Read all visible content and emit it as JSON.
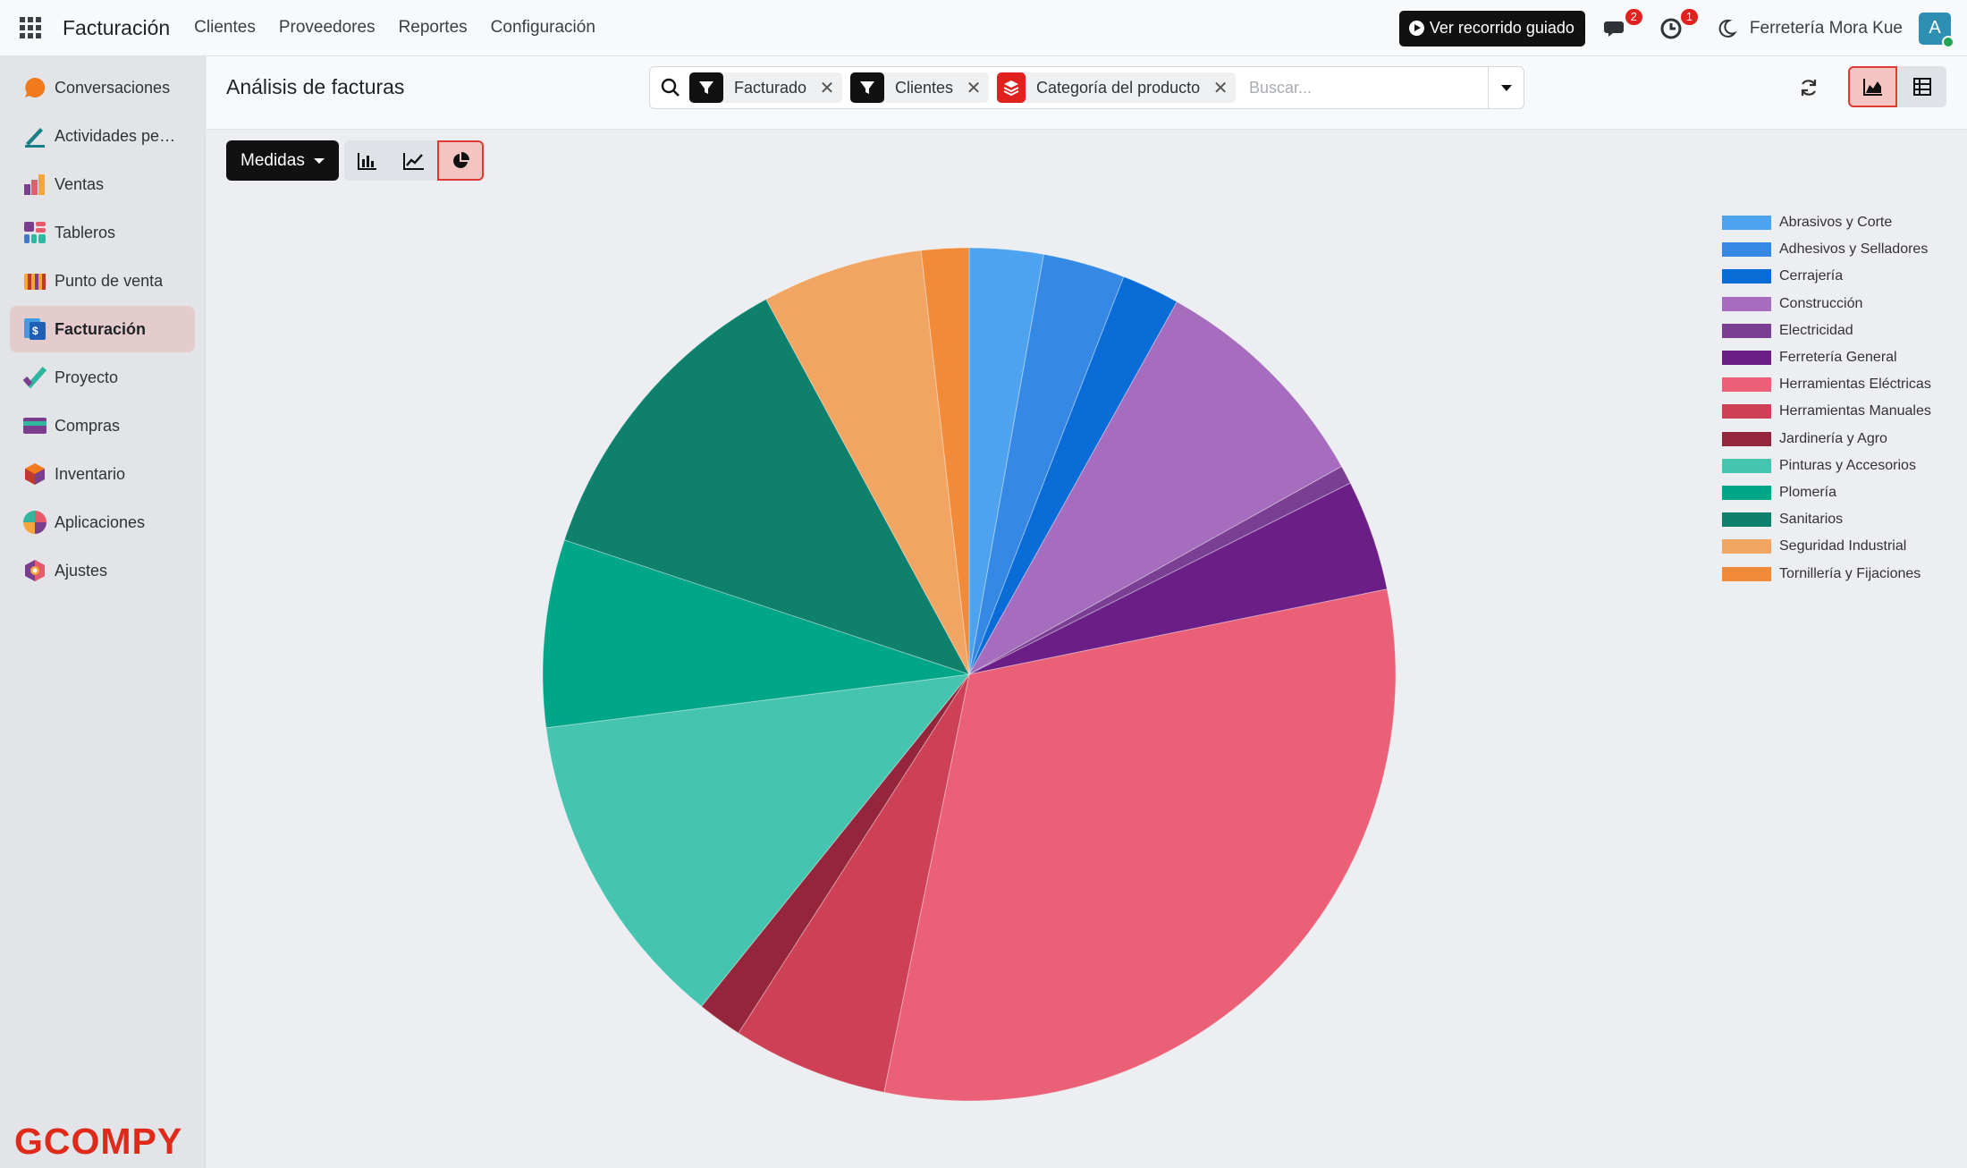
{
  "navbar": {
    "app_name": "Facturación",
    "menu": [
      "Clientes",
      "Proveedores",
      "Reportes",
      "Configuración"
    ],
    "tour_label": "Ver recorrido guiado",
    "messages_count": "2",
    "activities_count": "1",
    "company": "Ferretería Mora Kue",
    "avatar_letter": "A"
  },
  "sidebar": {
    "items": [
      {
        "label": "Conversaciones",
        "icon": "chat-bubble-icon"
      },
      {
        "label": "Actividades pe…",
        "icon": "pen-icon"
      },
      {
        "label": "Ventas",
        "icon": "sales-bars-icon"
      },
      {
        "label": "Tableros",
        "icon": "dashboard-icon"
      },
      {
        "label": "Punto de venta",
        "icon": "store-icon"
      },
      {
        "label": "Facturación",
        "icon": "invoice-icon",
        "active": true
      },
      {
        "label": "Proyecto",
        "icon": "check-icon"
      },
      {
        "label": "Compras",
        "icon": "card-icon"
      },
      {
        "label": "Inventario",
        "icon": "box-icon"
      },
      {
        "label": "Aplicaciones",
        "icon": "apps-icon"
      },
      {
        "label": "Ajustes",
        "icon": "settings-icon"
      }
    ],
    "footer_brand": "GCOMPY"
  },
  "control": {
    "title": "Análisis de facturas",
    "facets": [
      {
        "label": "Facturado",
        "type": "filter"
      },
      {
        "label": "Clientes",
        "type": "filter"
      },
      {
        "label": "Categoría del producto",
        "type": "groupby"
      }
    ],
    "search_placeholder": "Buscar..."
  },
  "toolbar": {
    "measures_label": "Medidas"
  },
  "colors": {
    "accent": "#e03a36",
    "active_bg": "#f5c5c4"
  },
  "chart_data": {
    "type": "pie",
    "title": "",
    "legend_position": "top-right",
    "slices": [
      {
        "label": "Abrasivos y Corte",
        "value": 2.8,
        "color": "#4da3ee"
      },
      {
        "label": "Adhesivos y Selladores",
        "value": 3.1,
        "color": "#3589e4"
      },
      {
        "label": "Cerrajería",
        "value": 2.2,
        "color": "#0a6cd6"
      },
      {
        "label": "Construcción",
        "value": 8.8,
        "color": "#a66cbd"
      },
      {
        "label": "Electricidad",
        "value": 0.7,
        "color": "#7a3f92"
      },
      {
        "label": "Ferretería General",
        "value": 4.2,
        "color": "#6b1f86"
      },
      {
        "label": "Herramientas Eléctricas",
        "value": 31.4,
        "color": "#ea6177"
      },
      {
        "label": "Herramientas Manuales",
        "value": 5.9,
        "color": "#cd4056"
      },
      {
        "label": "Jardinería y Agro",
        "value": 1.7,
        "color": "#95253a"
      },
      {
        "label": "Pinturas y Accesorios",
        "value": 12.2,
        "color": "#45c5b0"
      },
      {
        "label": "Plomería",
        "value": 7.1,
        "color": "#00a688"
      },
      {
        "label": "Sanitarios",
        "value": 12.0,
        "color": "#0f806c"
      },
      {
        "label": "Seguridad Industrial",
        "value": 6.1,
        "color": "#f2a563"
      },
      {
        "label": "Tornillería y Fijaciones",
        "value": 1.8,
        "color": "#f28b39"
      }
    ]
  }
}
